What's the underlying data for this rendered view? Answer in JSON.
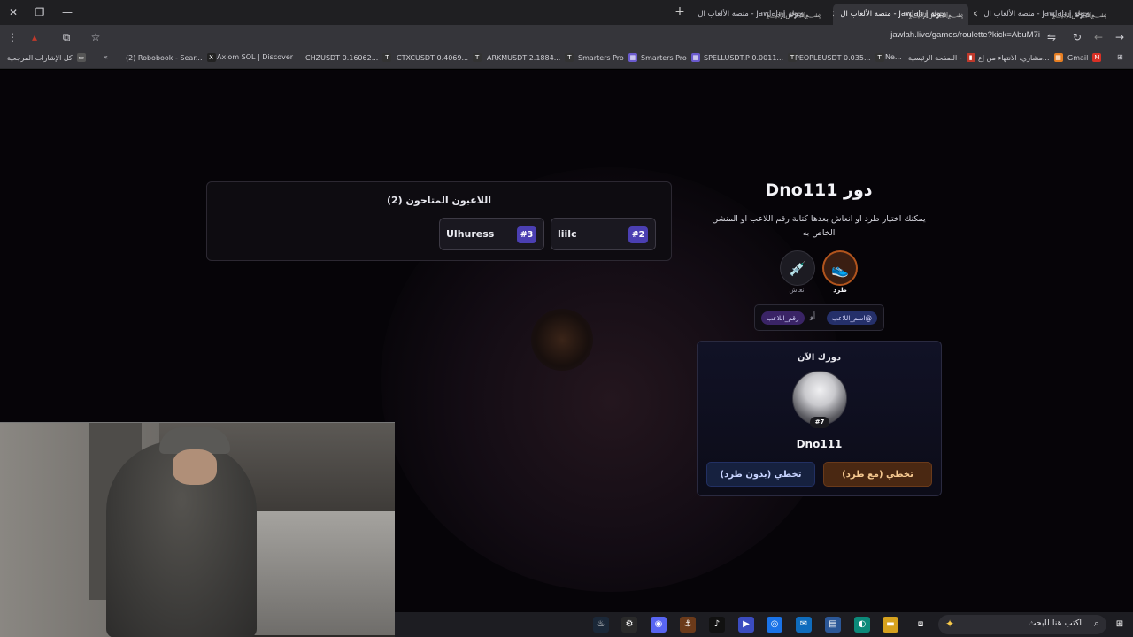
{
  "browser": {
    "tabs": [
      {
        "label": "جولة | Jawlah - منصة الألعاب ال",
        "active": false
      },
      {
        "label": "جولة | Jawlah - منصة الألعاب ال",
        "active": true
      },
      {
        "label": "جولة | Jawlah - منصة الألعاب ال",
        "active": false
      },
      {
        "label": "جولة | Jawlah - منصة الألعاب ال",
        "active": false
      }
    ],
    "url": "jawlah.live/games/roulette?kick=AbuM7i",
    "bookmarks": [
      "Gmail",
      "مشاري، الانتهاء من إع...",
      "Ne...",
      "الصفحة الرئيسية -",
      "PEOPLEUSDT 0.035...",
      "SPELLUSDT.P 0.0011...",
      "Smarters Pro",
      "Smarters Pro",
      "ARKMUSDT 2.1884...",
      "CTXCUSDT 0.4069...",
      "CHZUSDT 0.16062...",
      "Axiom SOL | Discover",
      "(2) Robobook - Sear...",
      "كل الإشارات المرجعية"
    ]
  },
  "game": {
    "players_title": "اللاعبون المتاحون (2)",
    "players": [
      {
        "name": "Ulhuress",
        "number": "#3"
      },
      {
        "name": "liilc",
        "number": "#2"
      }
    ],
    "turn_title": "دور Dno111",
    "turn_desc": "يمكنك اختيار طرد او انعاش بعدها كتابة رقم اللاعب او المنشن الخاص به",
    "action_kick": "طرد",
    "action_revive": "انعاش",
    "chip_name": "@اسم_اللاعب",
    "chip_or": "أو",
    "chip_number": "رقم_اللاعب",
    "now_label": "دورك الآن",
    "now_player": "Dno111",
    "now_badge": "#7",
    "btn_skip_kick": "تخطي (مع طرد)",
    "btn_skip_nokick": "تخطي (بدون طرد)"
  },
  "taskbar": {
    "search_placeholder": "اكتب هنا للبحث"
  },
  "colors": {
    "accent_purple": "#4b3fb2",
    "kick_orange": "#b1541d",
    "page_bg": "#060408"
  }
}
